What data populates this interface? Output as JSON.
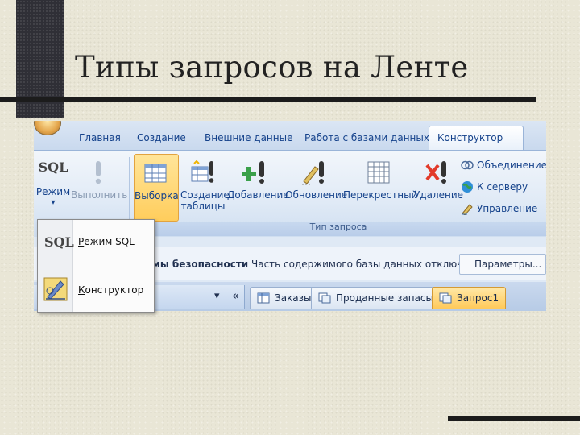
{
  "slide": {
    "title": "Типы запросов на Ленте"
  },
  "ribbon_tabs": [
    {
      "label": "Главная"
    },
    {
      "label": "Создание"
    },
    {
      "label": "Внешние данные"
    },
    {
      "label": "Работа с базами данных"
    },
    {
      "label": "Конструктор",
      "active": true
    }
  ],
  "ribbon": {
    "mode_button": {
      "icon_text": "SQL",
      "label": "Режим",
      "arrow": "▾"
    },
    "run_button": {
      "label": "Выполнить"
    },
    "query_types": [
      {
        "label": "Выборка",
        "selected": true
      },
      {
        "label": "Создание таблицы"
      },
      {
        "label": "Добавление"
      },
      {
        "label": "Обновление"
      },
      {
        "label": "Перекрестный"
      },
      {
        "label": "Удаление"
      }
    ],
    "small_buttons": [
      {
        "label": "Объединение",
        "icon": "rings-icon"
      },
      {
        "label": "К серверу",
        "icon": "globe-icon"
      },
      {
        "label": "Управление",
        "icon": "pen-icon"
      }
    ],
    "group_label": "Тип запроса"
  },
  "security_bar": {
    "warning_text": "темы безопасности",
    "message": "Часть содержимого базы данных отключено",
    "params_button": "Параметры..."
  },
  "nav_pane": {
    "dropdown_arrow": "▾",
    "collapse": "«"
  },
  "document_tabs": [
    {
      "label": "Заказы"
    },
    {
      "label": "Проданные запасы"
    },
    {
      "label": "Запрос1",
      "active": true
    }
  ],
  "mode_menu": [
    {
      "icon_text": "SQL",
      "label": "Режим SQL"
    },
    {
      "label": "Конструктор"
    }
  ],
  "colors": {
    "accent": "#15428b",
    "selected_button": "#ffcd5c",
    "slide_dark": "#2f2f36"
  }
}
